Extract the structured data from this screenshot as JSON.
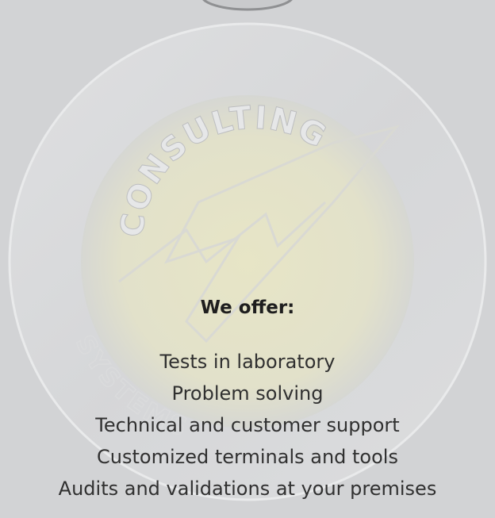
{
  "watermark": {
    "arc_text": "CONSULTING",
    "bottom_arc_text": "SYSTEMS",
    "colors": {
      "background": "#d2d3d5",
      "ring": "#e6e7e8",
      "inner_glow": "#e4e3c9",
      "emblem_stroke": "#dcdcd6"
    }
  },
  "offer": {
    "heading": "We offer:",
    "items": [
      "Tests in laboratory",
      "Problem solving",
      "Technical and customer support",
      "Customized terminals and tools",
      "Audits and validations at your premises"
    ]
  }
}
